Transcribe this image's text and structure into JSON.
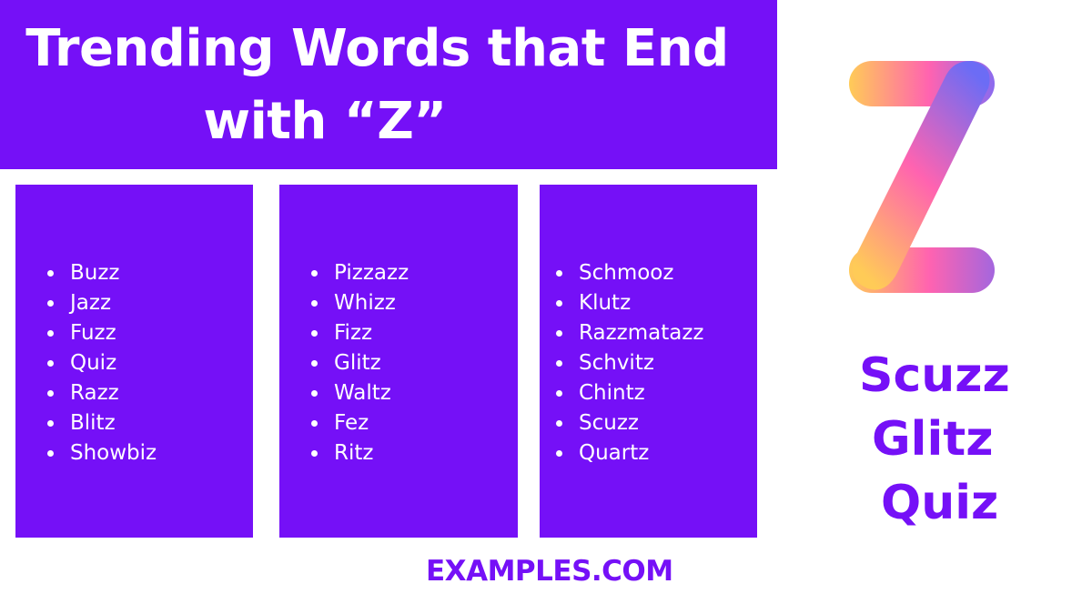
{
  "header": {
    "title_line1": "Trending Words that End",
    "title_line2": "with “Z”"
  },
  "columns": [
    {
      "words": [
        "Buzz",
        "Jazz",
        "Fuzz",
        "Quiz",
        "Razz",
        "Blitz",
        "Showbiz"
      ]
    },
    {
      "words": [
        "Pizzazz",
        "Whizz",
        "Fizz",
        "Glitz",
        "Waltz",
        "Fez",
        "Ritz"
      ]
    },
    {
      "words": [
        "Schmooz",
        "Klutz",
        "Razzmatazz",
        "Schvitz",
        "Chintz",
        "Scuzz",
        "Quartz"
      ]
    }
  ],
  "logo": {
    "icon": "gradient-letter-z-icon",
    "letter": "Z"
  },
  "featured_words": [
    "Scuzz",
    "Glitz",
    "Quiz"
  ],
  "footer": {
    "brand": "EXAMPLES.COM"
  },
  "colors": {
    "primary_purple": "#7510F7",
    "text_white": "#ffffff",
    "gradient": [
      "#FFCB57",
      "#FF63B0",
      "#6C6CF5"
    ]
  }
}
